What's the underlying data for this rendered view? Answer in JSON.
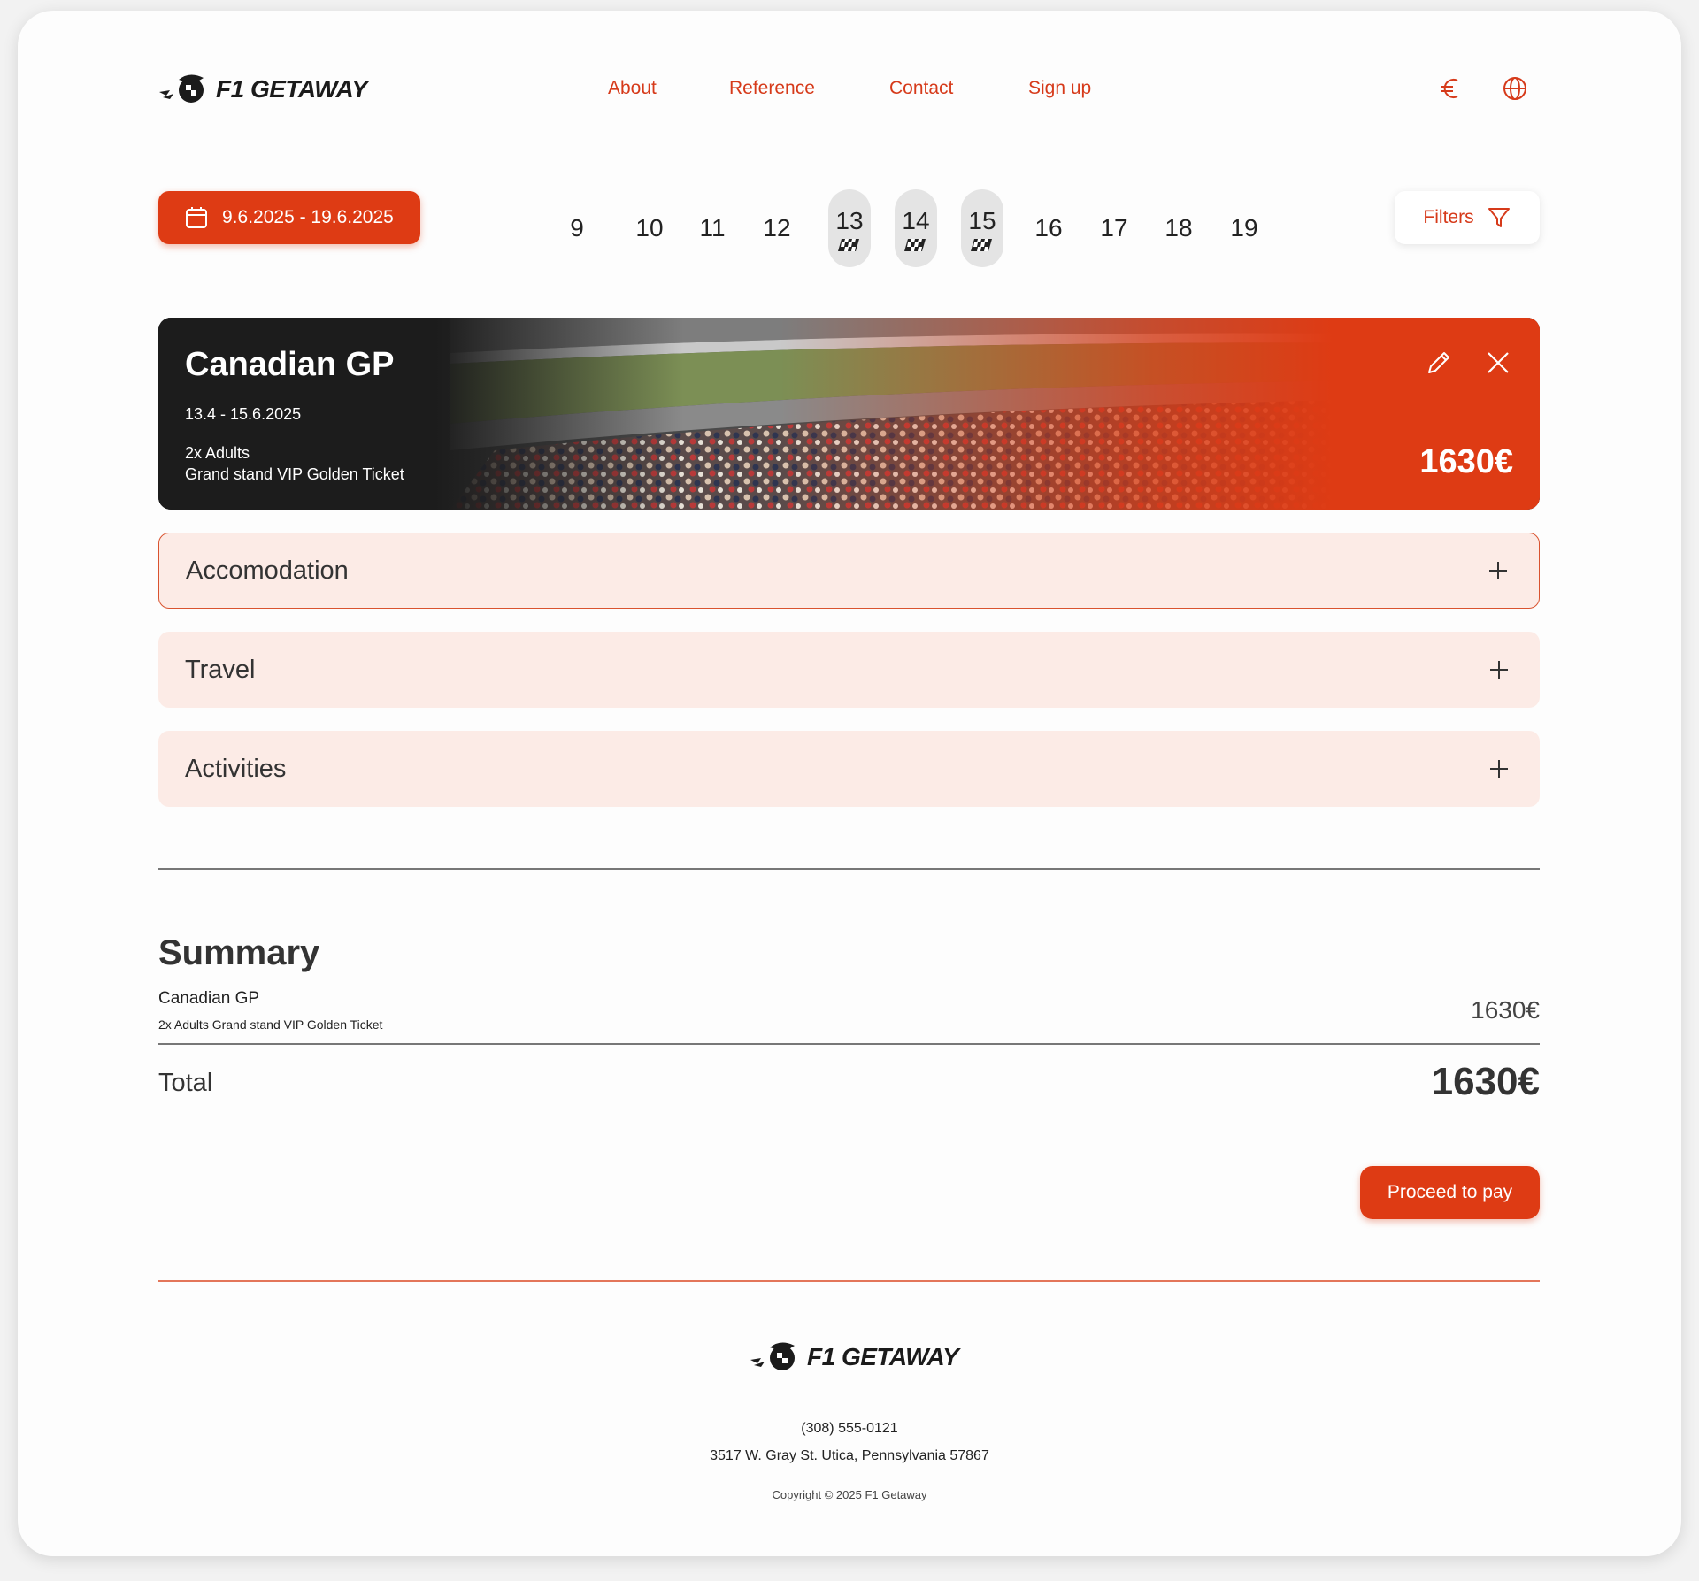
{
  "brand": {
    "name": "F1 GETAWAY",
    "accent": "#de3b14"
  },
  "nav": {
    "links": [
      "About",
      "Reference",
      "Contact",
      "Sign up"
    ],
    "currency_icon": "euro-icon",
    "language_icon": "globe-icon"
  },
  "date_range": {
    "label": "9.6.2025 - 19.6.2025",
    "icon": "calendar-icon"
  },
  "days": [
    {
      "day": "9",
      "race": false
    },
    {
      "day": "10",
      "race": false
    },
    {
      "day": "11",
      "race": false
    },
    {
      "day": "12",
      "race": false
    },
    {
      "day": "13",
      "race": true
    },
    {
      "day": "14",
      "race": true
    },
    {
      "day": "15",
      "race": true
    },
    {
      "day": "16",
      "race": false
    },
    {
      "day": "17",
      "race": false
    },
    {
      "day": "18",
      "race": false
    },
    {
      "day": "19",
      "race": false
    }
  ],
  "filters": {
    "label": "Filters",
    "icon": "filter-icon"
  },
  "event": {
    "title": "Canadian GP",
    "dates": "13.4 - 15.6.2025",
    "guests": "2x Adults",
    "ticket": "Grand stand VIP Golden Ticket",
    "price": "1630€"
  },
  "sections": [
    "Accomodation",
    "Travel",
    "Activities"
  ],
  "summary": {
    "title": "Summary",
    "item_name": "Canadian GP",
    "item_desc": "2x Adults Grand stand VIP Golden Ticket",
    "item_price": "1630€",
    "total_label": "Total",
    "total_value": "1630€",
    "pay_label": "Proceed to pay"
  },
  "footer": {
    "phone": "(308) 555-0121",
    "address": "3517 W. Gray St. Utica, Pennsylvania 57867",
    "copyright": "Copyright © 2025 F1 Getaway"
  }
}
